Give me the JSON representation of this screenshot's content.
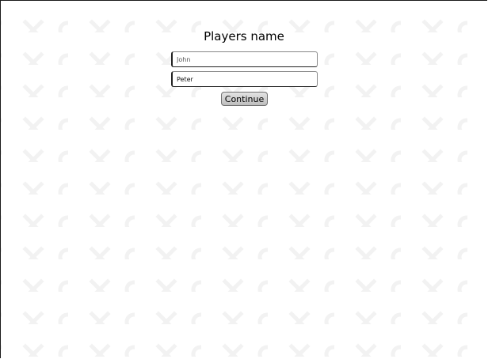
{
  "form": {
    "title": "Players name",
    "player1_value": "John",
    "player2_value": "Peter",
    "continue_label": "Continue"
  },
  "colors": {
    "background": "#ffffff",
    "pattern": "#f2f2f2",
    "button_top": "#e3e3e3",
    "button_bottom": "#bdbdbd"
  }
}
